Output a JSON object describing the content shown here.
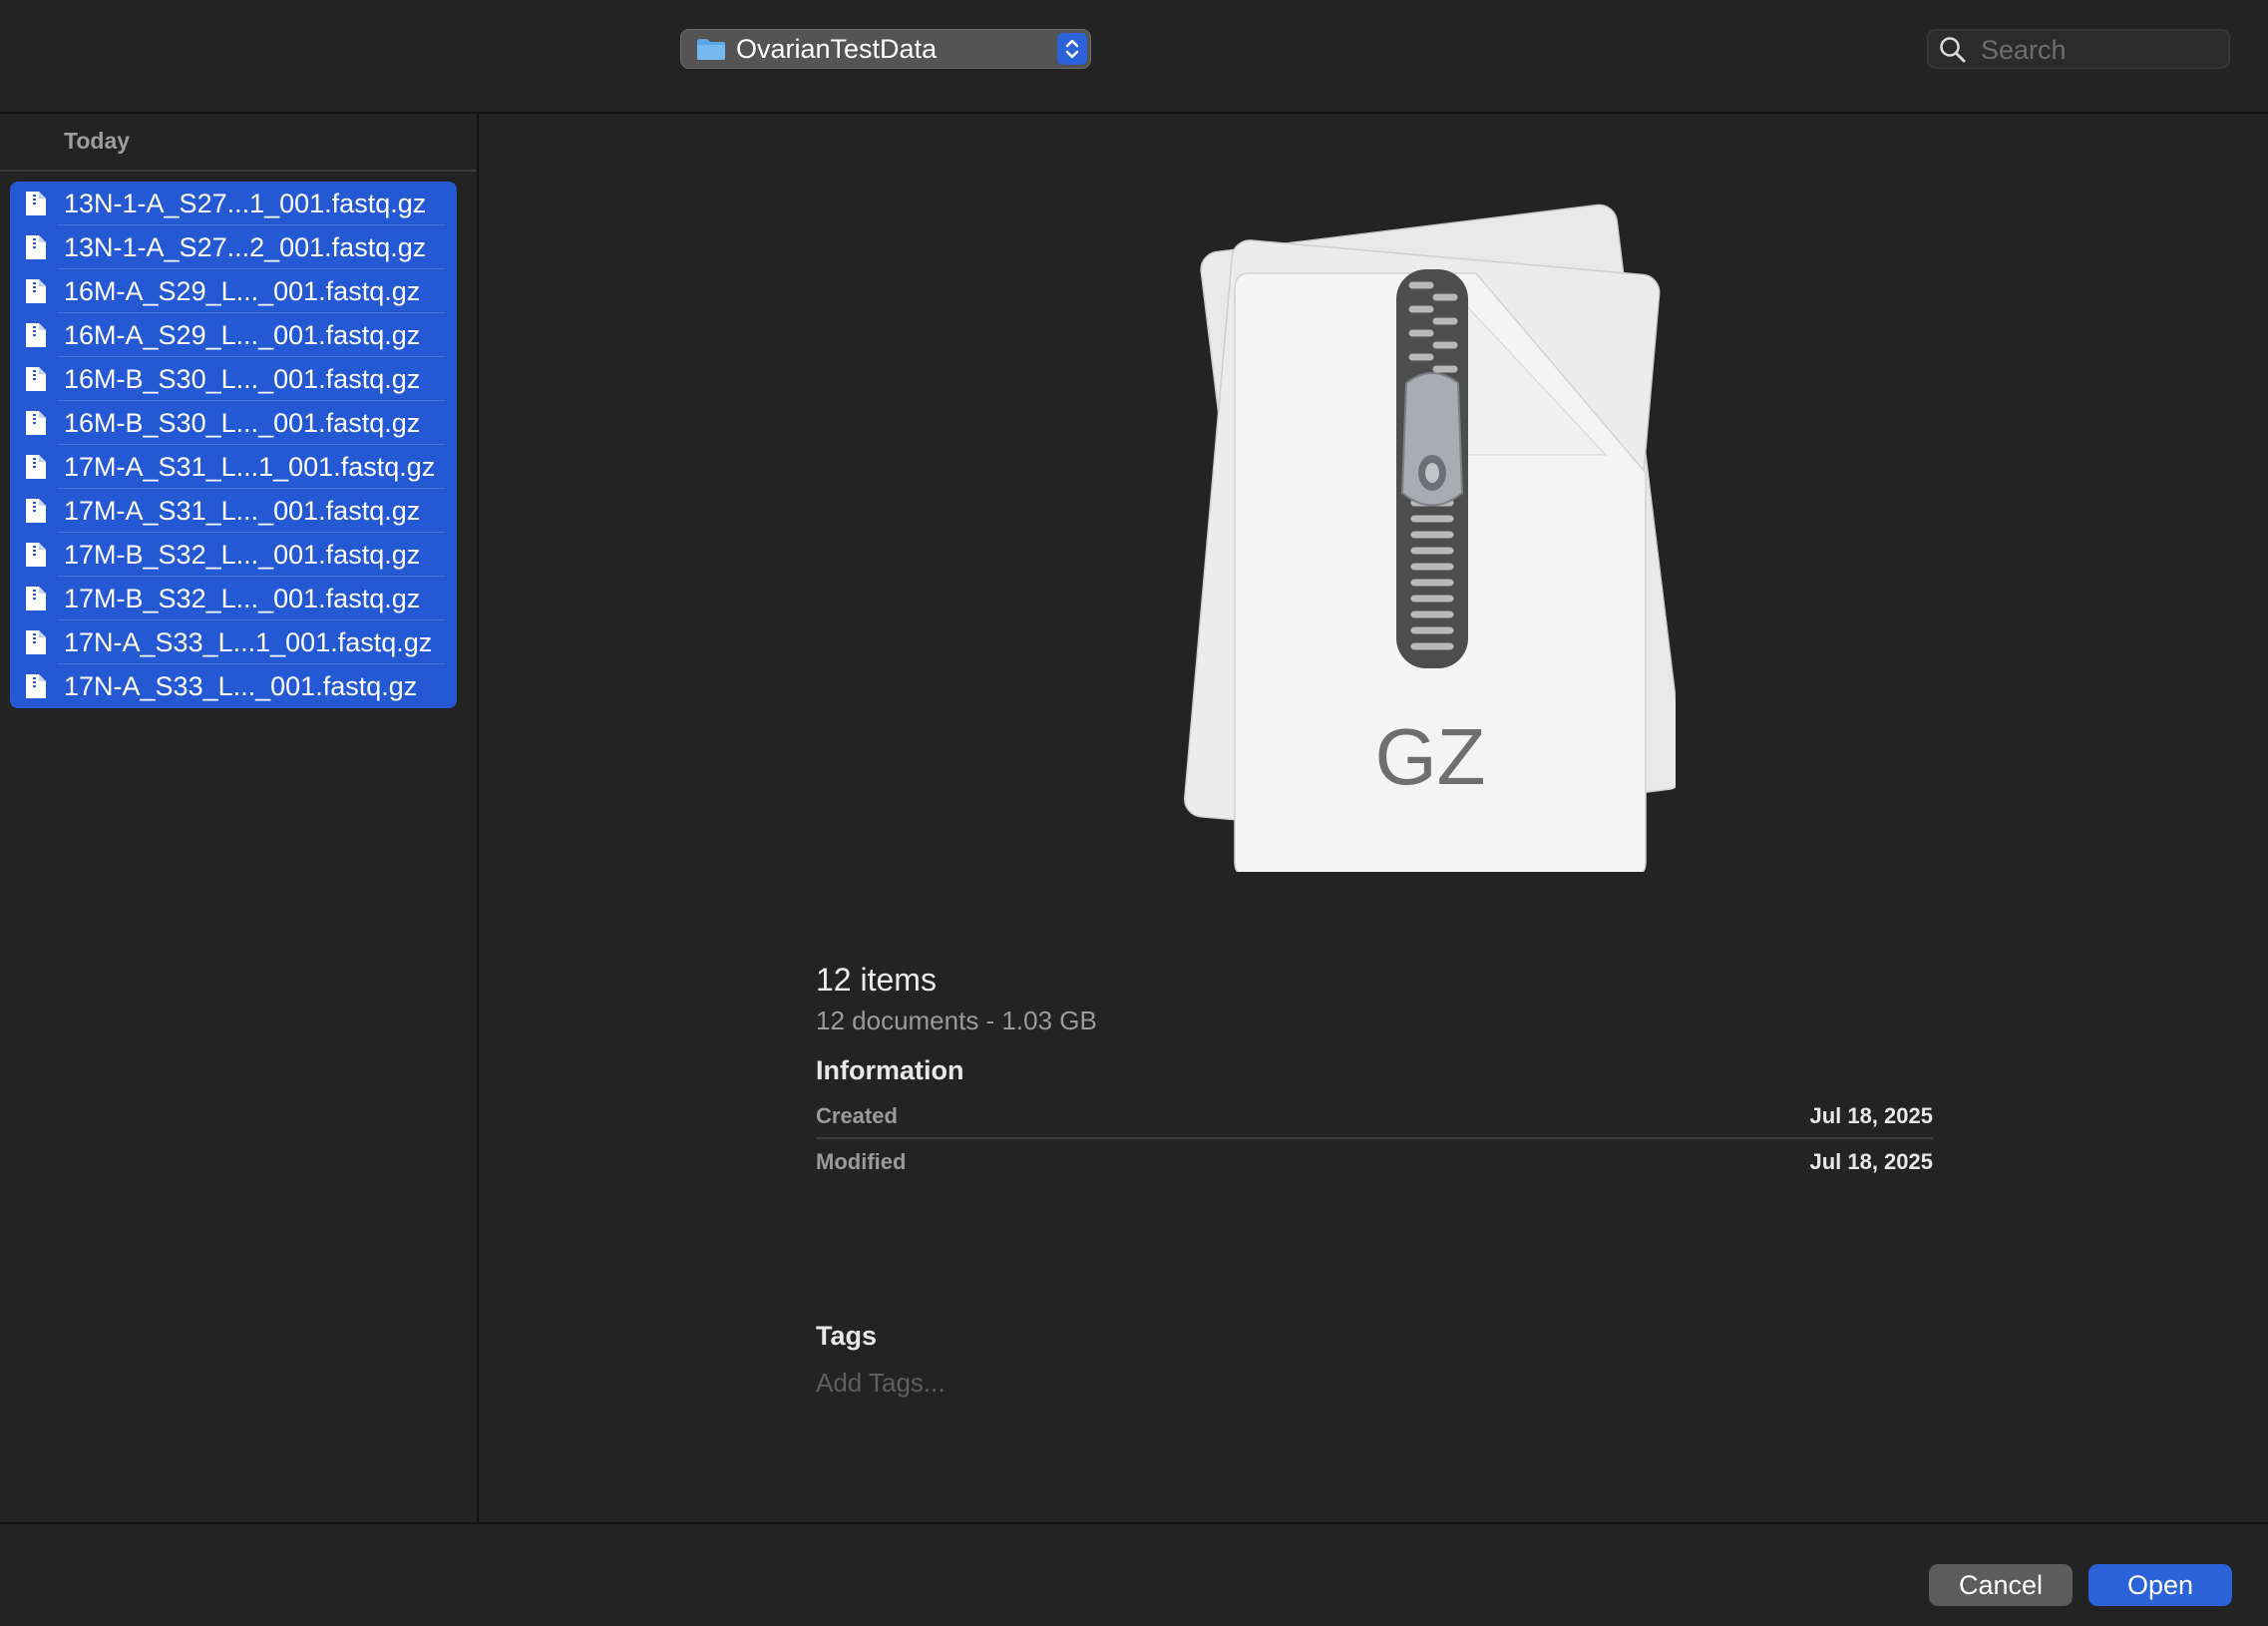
{
  "toolbar": {
    "location": "OvarianTestData",
    "search_placeholder": "Search"
  },
  "sidebar": {
    "group_header": "Today",
    "files": [
      "13N-1-A_S27...1_001.fastq.gz",
      "13N-1-A_S27...2_001.fastq.gz",
      "16M-A_S29_L..._001.fastq.gz",
      "16M-A_S29_L..._001.fastq.gz",
      "16M-B_S30_L..._001.fastq.gz",
      "16M-B_S30_L..._001.fastq.gz",
      "17M-A_S31_L...1_001.fastq.gz",
      "17M-A_S31_L..._001.fastq.gz",
      "17M-B_S32_L..._001.fastq.gz",
      "17M-B_S32_L..._001.fastq.gz",
      "17N-A_S33_L...1_001.fastq.gz",
      "17N-A_S33_L..._001.fastq.gz"
    ]
  },
  "preview": {
    "icon_label": "GZ",
    "title": "12 items",
    "subtitle": "12 documents - 1.03 GB",
    "information_heading": "Information",
    "created_label": "Created",
    "created_value": "Jul 18, 2025",
    "modified_label": "Modified",
    "modified_value": "Jul 18, 2025",
    "tags_heading": "Tags",
    "tags_placeholder": "Add Tags..."
  },
  "footer": {
    "cancel_label": "Cancel",
    "open_label": "Open"
  },
  "colors": {
    "accent": "#2559d4",
    "background": "#232323"
  },
  "icons": {
    "location": "folder-icon",
    "stepper": "up-down-chevron-icon",
    "search": "search-icon",
    "file": "document-icon",
    "preview": "archive-zip-icon"
  }
}
